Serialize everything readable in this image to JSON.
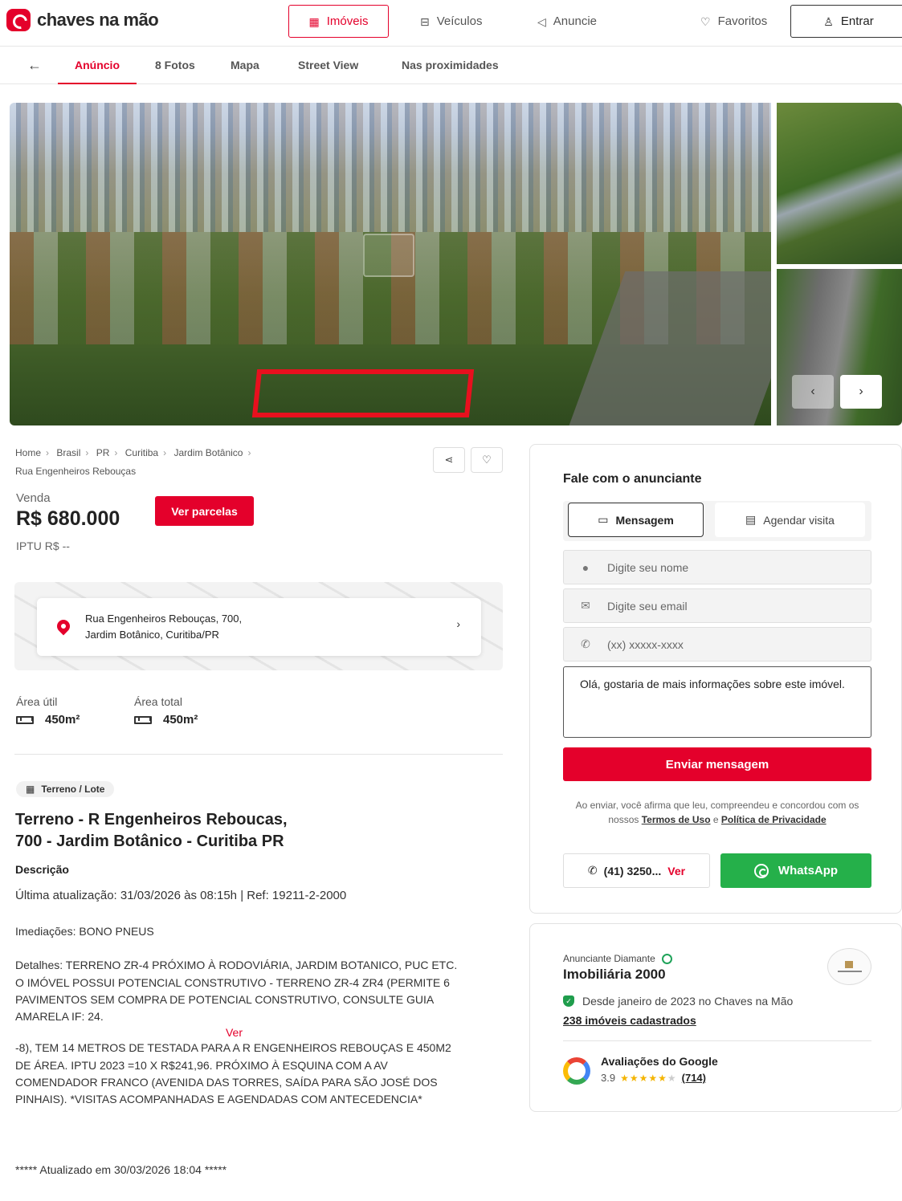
{
  "header": {
    "logo_text": "chaves na mão",
    "nav": {
      "imoveis": "Imóveis",
      "veiculos": "Veículos",
      "anuncie": "Anuncie",
      "favoritos": "Favoritos",
      "entrar": "Entrar"
    }
  },
  "tabs": {
    "anuncio": "Anúncio",
    "fotos": "8 Fotos",
    "mapa": "Mapa",
    "street_view": "Street View",
    "proximidades": "Nas proximidades"
  },
  "breadcrumb": {
    "items": [
      "Home",
      "Brasil",
      "PR",
      "Curitiba",
      "Jardim Botânico"
    ],
    "last": "Rua Engenheiros Rebouças"
  },
  "pricing": {
    "label": "Venda",
    "price": "R$ 680.000",
    "parcelas_button": "Ver parcelas",
    "iptu": "IPTU  R$ --"
  },
  "address": {
    "line1": "Rua Engenheiros Rebouças, 700,",
    "line2": "Jardim Botânico, Curitiba/PR"
  },
  "areas": {
    "util_label": "Área útil",
    "util_value": "450m²",
    "total_label": "Área total",
    "total_value": "450m²"
  },
  "listing": {
    "type": "Terreno / Lote",
    "title_line1": "Terreno - R Engenheiros Reboucas,",
    "title_line2": "700 - Jardim Botânico - Curitiba PR",
    "desc_heading": "Descrição",
    "update_line": "Última atualização: 31/03/2026 às 08:15h | Ref: 19211-2-2000",
    "imediacoes": "Imediações: BONO PNEUS",
    "detalhes": "Detalhes: TERRENO ZR-4 PRÓXIMO À RODOVIÁRIA, JARDIM BOTANICO, PUC ETC.",
    "potencial": "O IMÓVEL POSSUI POTENCIAL CONSTRUTIVO - TERRENO ZR-4 ZR4 (PERMITE 6 PAVIMENTOS SEM COMPRA DE POTENCIAL CONSTRUTIVO, CONSULTE GUIA AMARELA IF: 24.",
    "ver": "Ver",
    "continuacao": "-8), TEM 14 METROS DE TESTADA PARA A R ENGENHEIROS REBOUÇAS E 450M2 DE ÁREA. IPTU 2023 =10 X R$241,96. PRÓXIMO À ESQUINA COM A AV COMENDADOR FRANCO (AVENIDA DAS TORRES, SAÍDA PARA SÃO JOSÉ DOS PINHAIS). *VISITAS ACOMPANHADAS E AGENDADAS COM ANTECEDENCIA*",
    "footer": "***** Atualizado em 30/03/2026 18:04 *****"
  },
  "contact": {
    "title": "Fale com o anunciante",
    "tab_message": "Mensagem",
    "tab_visit": "Agendar visita",
    "name_placeholder": "Digite seu nome",
    "email_placeholder": "Digite seu email",
    "phone_placeholder": "(xx) xxxxx-xxxx",
    "message_value": "Olá, gostaria de mais informações sobre este imóvel.",
    "send_button": "Enviar mensagem",
    "legal_prefix": "Ao enviar, você afirma que leu, compreendeu e concordou com os nossos",
    "terms_link": "Termos de Uso",
    "legal_and": "e",
    "privacy_link": "Política de Privacidade",
    "phone_number": "(41) 3250...",
    "phone_ver": "Ver",
    "whatsapp": "WhatsApp"
  },
  "advertiser": {
    "tier": "Anunciante Diamante",
    "name": "Imobiliária 2000",
    "since": "Desde janeiro de 2023 no Chaves na Mão",
    "count": "238 imóveis cadastrados",
    "google_title": "Avaliações do Google",
    "google_rating": "3.9",
    "google_count": "(714)"
  },
  "colors": {
    "brand_red": "#e4002b",
    "whatsapp_green": "#25b04a"
  }
}
